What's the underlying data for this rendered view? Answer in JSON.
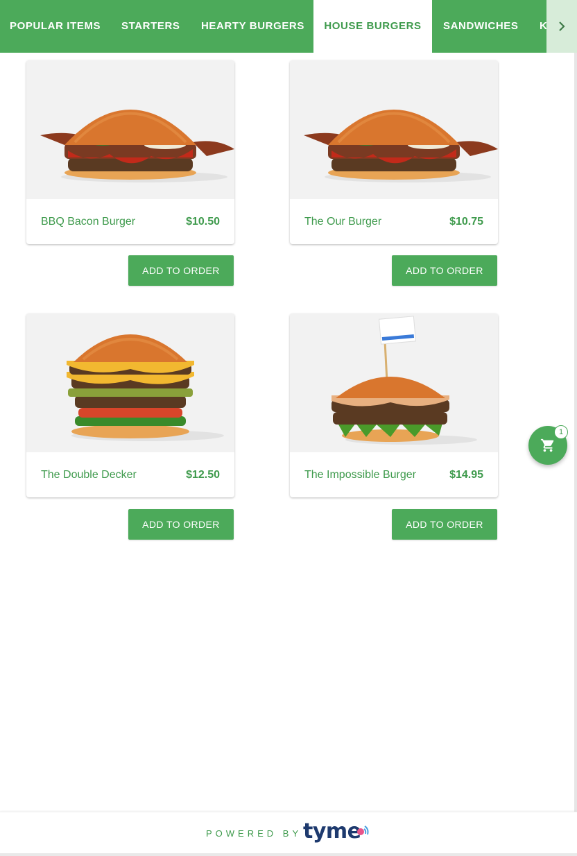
{
  "tabs": [
    {
      "label": "POPULAR ITEMS",
      "active": false
    },
    {
      "label": "STARTERS",
      "active": false
    },
    {
      "label": "HEARTY BURGERS",
      "active": false
    },
    {
      "label": "HOUSE BURGERS",
      "active": true
    },
    {
      "label": "SANDWICHES",
      "active": false
    },
    {
      "label": "K",
      "active": false
    }
  ],
  "scroll_icon": "chevron-right-icon",
  "items": [
    {
      "name": "BBQ Bacon Burger",
      "price": "$10.50",
      "image": "bbq-bacon-burger-photo"
    },
    {
      "name": "The Our Burger",
      "price": "$10.75",
      "image": "bbq-bacon-burger-photo"
    },
    {
      "name": "The Double Decker",
      "price": "$12.50",
      "image": "double-decker-burger-photo"
    },
    {
      "name": "The Impossible Burger",
      "price": "$14.95",
      "image": "impossible-burger-photo"
    }
  ],
  "add_button_label": "ADD TO ORDER",
  "cart": {
    "icon": "cart-icon",
    "count": "1"
  },
  "footer": {
    "powered_by": "POWERED BY",
    "brand": "tyme"
  },
  "colors": {
    "primary": "#4caa5a",
    "primary_text": "#3e9a4c",
    "brand_navy": "#1e3a6e",
    "brand_pink": "#e8558a"
  }
}
